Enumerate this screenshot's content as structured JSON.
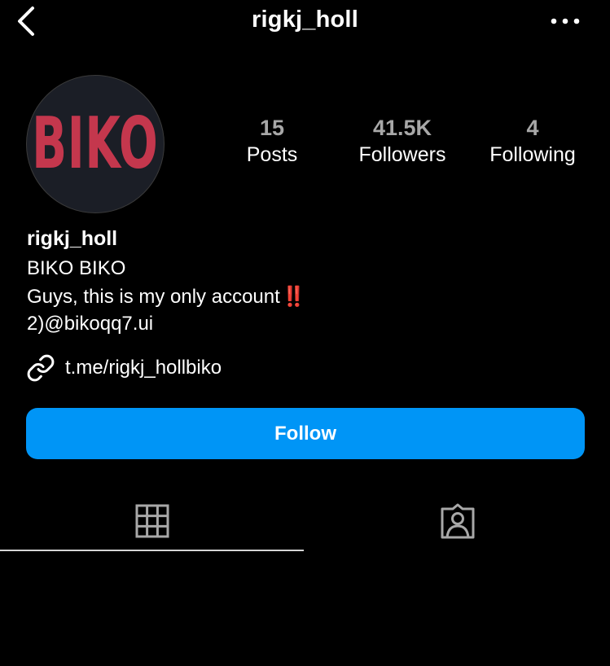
{
  "header": {
    "title": "rigkj_holl",
    "back_icon": "chevron-left-icon",
    "more_icon": "more-horizontal-icon"
  },
  "avatar": {
    "text": "BIKO",
    "text_color": "#c4374d",
    "bg_color": "#1b1e26"
  },
  "stats": [
    {
      "value": "15",
      "label": "Posts"
    },
    {
      "value": "41.5K",
      "label": "Followers"
    },
    {
      "value": "4",
      "label": "Following"
    }
  ],
  "profile": {
    "username": "rigkj_holl",
    "bio_lines": [
      "BIKO BIKO",
      "Guys, this is my only account",
      "2)@bikoqq7.ui"
    ],
    "bio_emoji": "‼️",
    "link_icon": "link-icon",
    "link": "t.me/rigkj_hollbiko"
  },
  "follow_button": {
    "label": "Follow",
    "color": "#0095f6"
  },
  "tabs": [
    {
      "icon": "grid-icon",
      "active": true
    },
    {
      "icon": "tagged-person-icon",
      "active": false
    }
  ]
}
